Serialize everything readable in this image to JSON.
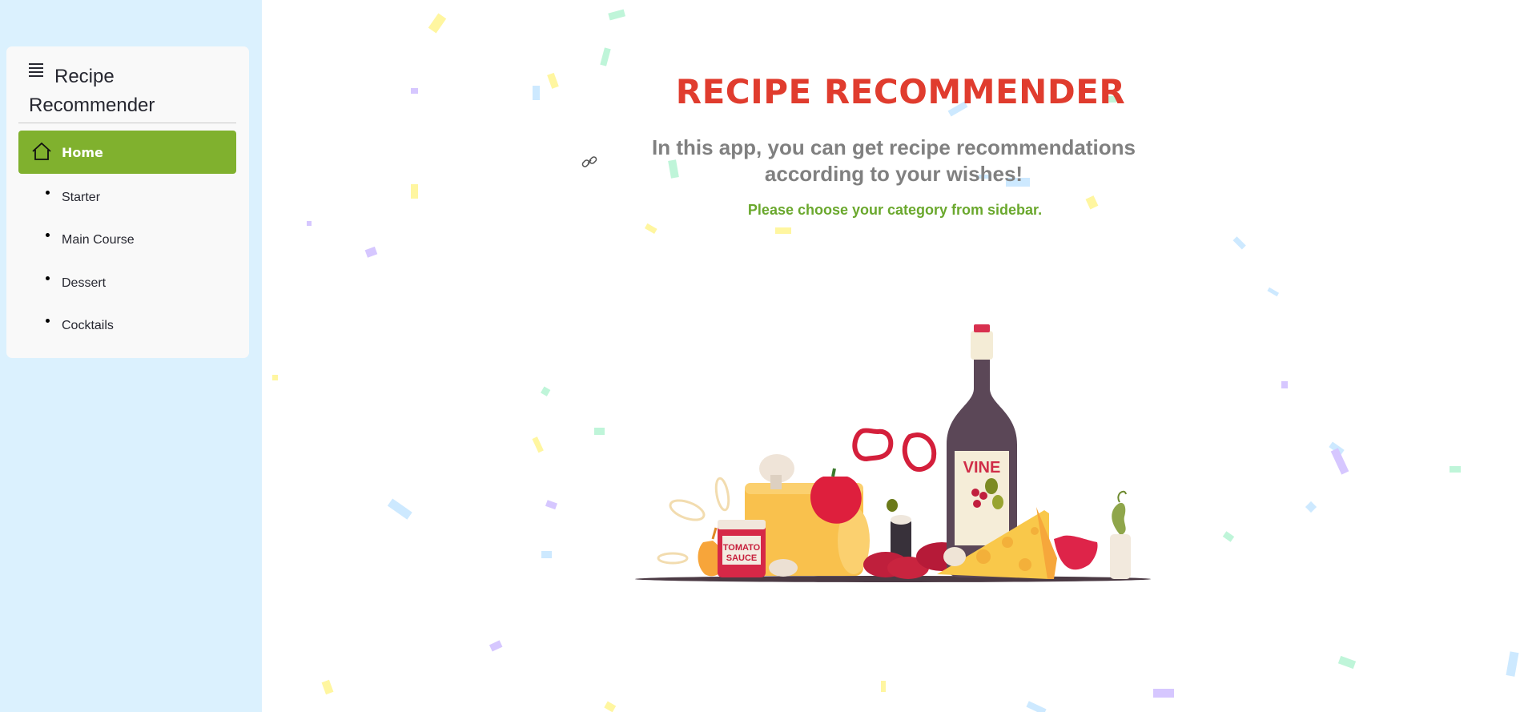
{
  "sidebar": {
    "menu_title": "Recipe Recommender",
    "menu_icon": "hamburger-icon",
    "items": [
      {
        "label": "Home",
        "icon": "house-icon",
        "active": true
      },
      {
        "label": "Starter"
      },
      {
        "label": "Main Course"
      },
      {
        "label": "Dessert"
      },
      {
        "label": "Cocktails"
      }
    ]
  },
  "main": {
    "title": "RECIPE RECOMMENDER",
    "subtitle": "In this app, you can get recipe recommendations according to your wishes!",
    "note": "Please choose your category from sidebar.",
    "anchor_icon": "link-icon",
    "illustration": {
      "jar_label_1": "TOMATO",
      "jar_label_2": "SAUCE",
      "bottle_label": "VINE"
    }
  },
  "colors": {
    "sidebar_bg": "#dbf1fe",
    "active_nav": "#80b12e",
    "title": "#e03c2e",
    "subtitle": "#808080",
    "note": "#6aa82d"
  }
}
